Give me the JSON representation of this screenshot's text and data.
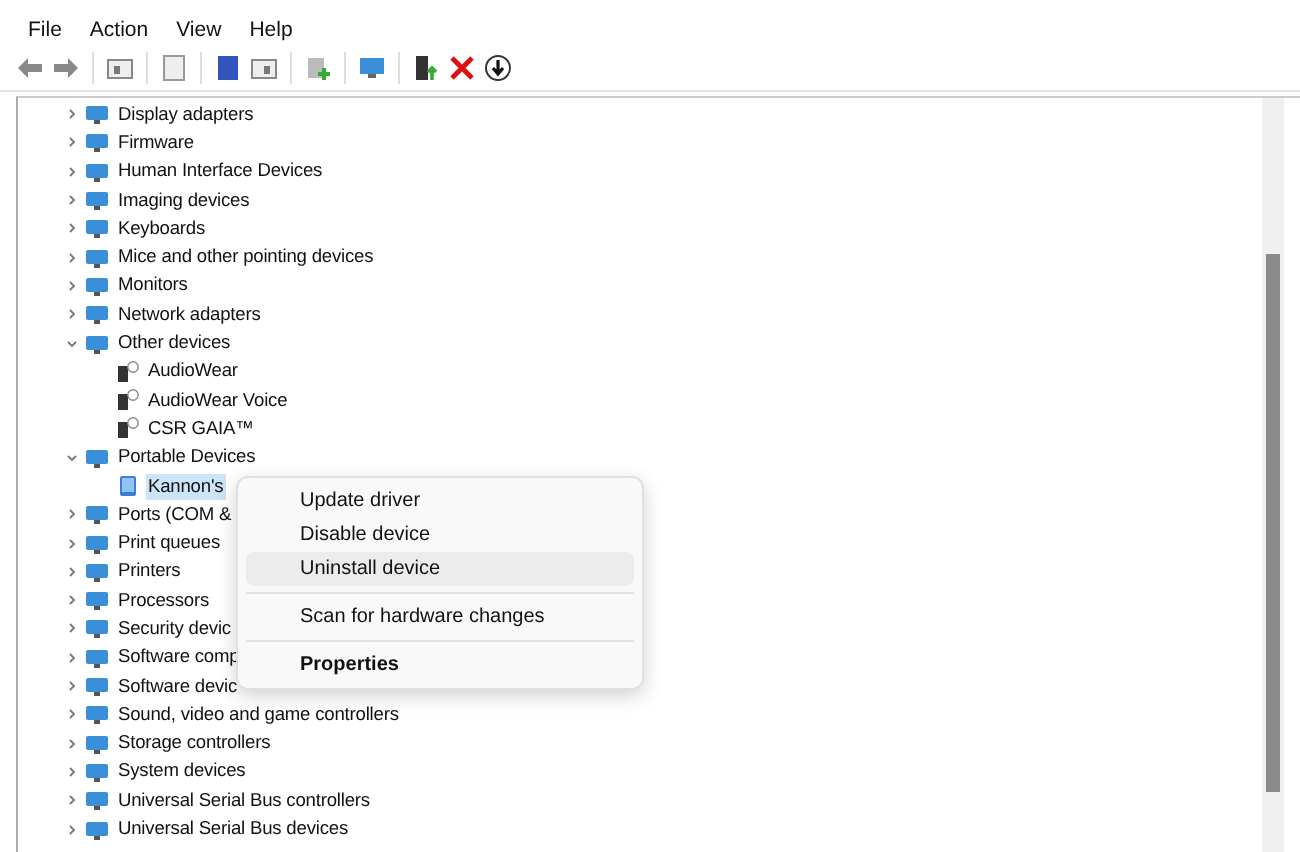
{
  "menu_bar": [
    "File",
    "Action",
    "View",
    "Help"
  ],
  "tree": [
    {
      "label": "Display adapters",
      "expanded": false
    },
    {
      "label": "Firmware",
      "expanded": false
    },
    {
      "label": "Human Interface Devices",
      "expanded": false
    },
    {
      "label": "Imaging devices",
      "expanded": false
    },
    {
      "label": "Keyboards",
      "expanded": false
    },
    {
      "label": "Mice and other pointing devices",
      "expanded": false
    },
    {
      "label": "Monitors",
      "expanded": false
    },
    {
      "label": "Network adapters",
      "expanded": false
    },
    {
      "label": "Other devices",
      "expanded": true,
      "children": [
        {
          "label": "AudioWear",
          "selected": false
        },
        {
          "label": "AudioWear Voice",
          "selected": false
        },
        {
          "label": "CSR GAIA™",
          "selected": false
        }
      ]
    },
    {
      "label": "Portable Devices",
      "expanded": true,
      "children": [
        {
          "label": "Kannon's",
          "selected": true
        }
      ]
    },
    {
      "label": "Ports (COM &",
      "expanded": false
    },
    {
      "label": "Print queues",
      "expanded": false
    },
    {
      "label": "Printers",
      "expanded": false
    },
    {
      "label": "Processors",
      "expanded": false
    },
    {
      "label": "Security devic",
      "expanded": false
    },
    {
      "label": "Software comp",
      "expanded": false
    },
    {
      "label": "Software devic",
      "expanded": false
    },
    {
      "label": "Sound, video and game controllers",
      "expanded": false
    },
    {
      "label": "Storage controllers",
      "expanded": false
    },
    {
      "label": "System devices",
      "expanded": false
    },
    {
      "label": "Universal Serial Bus controllers",
      "expanded": false
    },
    {
      "label": "Universal Serial Bus devices",
      "expanded": false
    }
  ],
  "context_menu": [
    [
      {
        "label": "Update driver",
        "selected": false,
        "bold": false
      },
      {
        "label": "Disable device",
        "selected": false,
        "bold": false
      },
      {
        "label": "Uninstall device",
        "selected": true,
        "bold": false
      }
    ],
    [
      {
        "label": "Scan for hardware changes",
        "selected": false,
        "bold": false
      }
    ],
    [
      {
        "label": "Properties",
        "selected": false,
        "bold": true
      }
    ]
  ]
}
